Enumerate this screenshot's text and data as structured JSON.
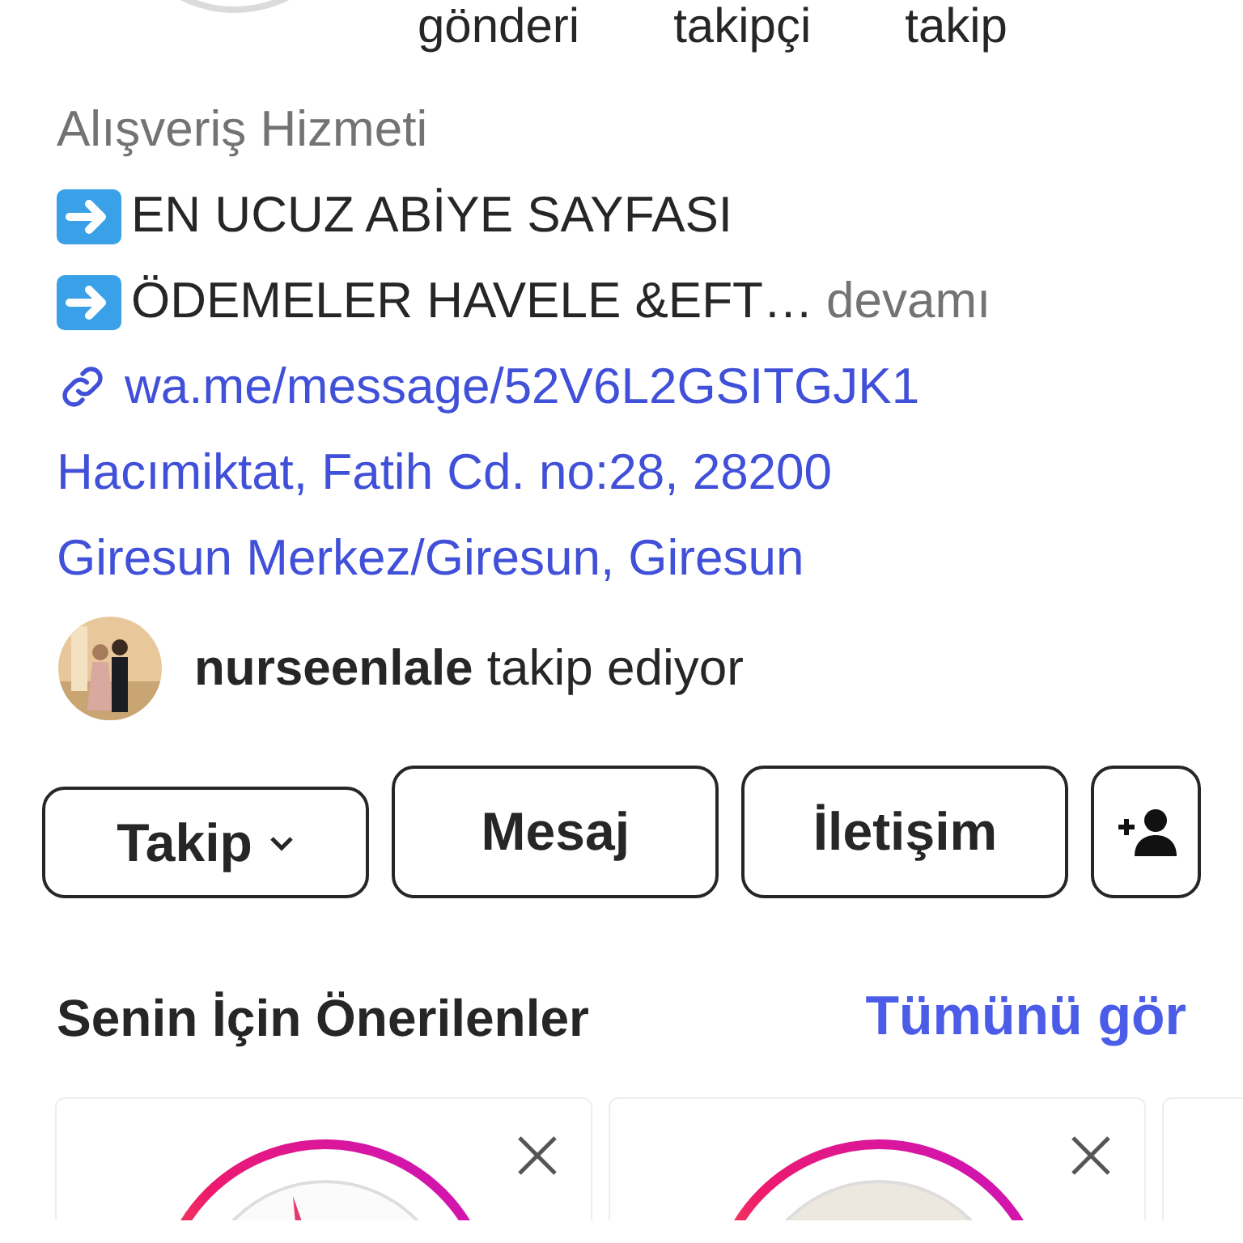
{
  "stats": [
    {
      "label": "gönderi"
    },
    {
      "label": "takipçi"
    },
    {
      "label": "takip"
    }
  ],
  "category": "Alışveriş Hizmeti",
  "bio_lines": [
    {
      "kind": "arrow",
      "text": "EN UCUZ ABİYE SAYFASI"
    },
    {
      "kind": "arrow",
      "text": "ÖDEMELER HAVELE &EFT…",
      "more": "devamı"
    }
  ],
  "link": "wa.me/message/52V6L2GSITGJK1",
  "address_lines": [
    "Hacımiktat, Fatih Cd. no:28, 28200",
    "Giresun Merkez/Giresun, Giresun"
  ],
  "followed_by": {
    "username": "nurseenlale",
    "text": "takip ediyor"
  },
  "buttons": [
    {
      "kind": "dropdown",
      "label": "Takip"
    },
    {
      "kind": "text",
      "label": "Mesaj"
    },
    {
      "kind": "text",
      "label": "İletişim"
    },
    {
      "kind": "add_person"
    }
  ],
  "suggestions": {
    "title": "Senin İçin Önerilenler",
    "see_all": "Tümünü gör"
  }
}
